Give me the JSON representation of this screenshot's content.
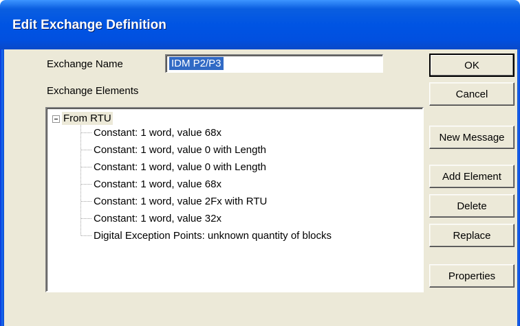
{
  "dialog": {
    "title": "Edit Exchange Definition",
    "exchange_name_label": "Exchange Name",
    "exchange_name_value": "IDM P2/P3",
    "exchange_elements_label": "Exchange Elements"
  },
  "tree": {
    "root": "From RTU",
    "root_expanded": true,
    "items": [
      "Constant: 1 word, value 68x",
      "Constant: 1 word, value 0 with Length",
      "Constant: 1 word, value 0 with Length",
      "Constant: 1 word, value 68x",
      "Constant: 1 word, value 2Fx with RTU",
      "Constant: 1 word, value 32x",
      "Digital Exception Points: unknown quantity of blocks"
    ]
  },
  "buttons": {
    "ok": "OK",
    "cancel": "Cancel",
    "new_message": "New Message",
    "add_element": "Add Element",
    "delete": "Delete",
    "replace": "Replace",
    "properties": "Properties"
  },
  "colors": {
    "titlebar": "#0054e3",
    "dialog_bg": "#ece9d8",
    "selection": "#316ac5"
  },
  "icons": {
    "tree_expander": "minus-box-icon"
  }
}
